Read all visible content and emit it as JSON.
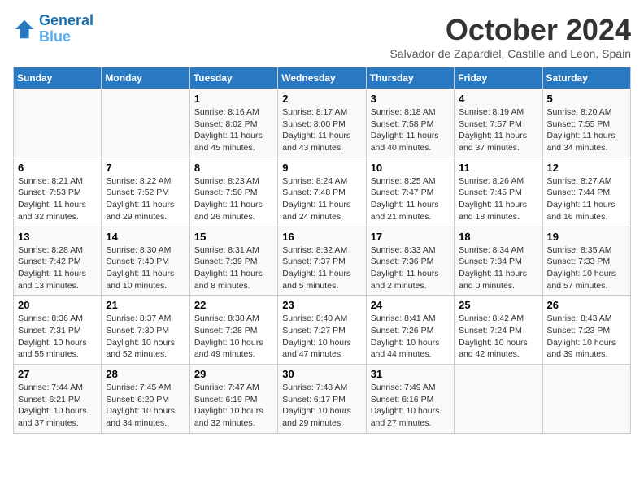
{
  "logo": {
    "line1": "General",
    "line2": "Blue"
  },
  "title": "October 2024",
  "subtitle": "Salvador de Zapardiel, Castille and Leon, Spain",
  "headers": [
    "Sunday",
    "Monday",
    "Tuesday",
    "Wednesday",
    "Thursday",
    "Friday",
    "Saturday"
  ],
  "weeks": [
    [
      {
        "day": "",
        "info": ""
      },
      {
        "day": "",
        "info": ""
      },
      {
        "day": "1",
        "sunrise": "8:16 AM",
        "sunset": "8:02 PM",
        "daylight": "11 hours and 45 minutes."
      },
      {
        "day": "2",
        "sunrise": "8:17 AM",
        "sunset": "8:00 PM",
        "daylight": "11 hours and 43 minutes."
      },
      {
        "day": "3",
        "sunrise": "8:18 AM",
        "sunset": "7:58 PM",
        "daylight": "11 hours and 40 minutes."
      },
      {
        "day": "4",
        "sunrise": "8:19 AM",
        "sunset": "7:57 PM",
        "daylight": "11 hours and 37 minutes."
      },
      {
        "day": "5",
        "sunrise": "8:20 AM",
        "sunset": "7:55 PM",
        "daylight": "11 hours and 34 minutes."
      }
    ],
    [
      {
        "day": "6",
        "sunrise": "8:21 AM",
        "sunset": "7:53 PM",
        "daylight": "11 hours and 32 minutes."
      },
      {
        "day": "7",
        "sunrise": "8:22 AM",
        "sunset": "7:52 PM",
        "daylight": "11 hours and 29 minutes."
      },
      {
        "day": "8",
        "sunrise": "8:23 AM",
        "sunset": "7:50 PM",
        "daylight": "11 hours and 26 minutes."
      },
      {
        "day": "9",
        "sunrise": "8:24 AM",
        "sunset": "7:48 PM",
        "daylight": "11 hours and 24 minutes."
      },
      {
        "day": "10",
        "sunrise": "8:25 AM",
        "sunset": "7:47 PM",
        "daylight": "11 hours and 21 minutes."
      },
      {
        "day": "11",
        "sunrise": "8:26 AM",
        "sunset": "7:45 PM",
        "daylight": "11 hours and 18 minutes."
      },
      {
        "day": "12",
        "sunrise": "8:27 AM",
        "sunset": "7:44 PM",
        "daylight": "11 hours and 16 minutes."
      }
    ],
    [
      {
        "day": "13",
        "sunrise": "8:28 AM",
        "sunset": "7:42 PM",
        "daylight": "11 hours and 13 minutes."
      },
      {
        "day": "14",
        "sunrise": "8:30 AM",
        "sunset": "7:40 PM",
        "daylight": "11 hours and 10 minutes."
      },
      {
        "day": "15",
        "sunrise": "8:31 AM",
        "sunset": "7:39 PM",
        "daylight": "11 hours and 8 minutes."
      },
      {
        "day": "16",
        "sunrise": "8:32 AM",
        "sunset": "7:37 PM",
        "daylight": "11 hours and 5 minutes."
      },
      {
        "day": "17",
        "sunrise": "8:33 AM",
        "sunset": "7:36 PM",
        "daylight": "11 hours and 2 minutes."
      },
      {
        "day": "18",
        "sunrise": "8:34 AM",
        "sunset": "7:34 PM",
        "daylight": "11 hours and 0 minutes."
      },
      {
        "day": "19",
        "sunrise": "8:35 AM",
        "sunset": "7:33 PM",
        "daylight": "10 hours and 57 minutes."
      }
    ],
    [
      {
        "day": "20",
        "sunrise": "8:36 AM",
        "sunset": "7:31 PM",
        "daylight": "10 hours and 55 minutes."
      },
      {
        "day": "21",
        "sunrise": "8:37 AM",
        "sunset": "7:30 PM",
        "daylight": "10 hours and 52 minutes."
      },
      {
        "day": "22",
        "sunrise": "8:38 AM",
        "sunset": "7:28 PM",
        "daylight": "10 hours and 49 minutes."
      },
      {
        "day": "23",
        "sunrise": "8:40 AM",
        "sunset": "7:27 PM",
        "daylight": "10 hours and 47 minutes."
      },
      {
        "day": "24",
        "sunrise": "8:41 AM",
        "sunset": "7:26 PM",
        "daylight": "10 hours and 44 minutes."
      },
      {
        "day": "25",
        "sunrise": "8:42 AM",
        "sunset": "7:24 PM",
        "daylight": "10 hours and 42 minutes."
      },
      {
        "day": "26",
        "sunrise": "8:43 AM",
        "sunset": "7:23 PM",
        "daylight": "10 hours and 39 minutes."
      }
    ],
    [
      {
        "day": "27",
        "sunrise": "7:44 AM",
        "sunset": "6:21 PM",
        "daylight": "10 hours and 37 minutes."
      },
      {
        "day": "28",
        "sunrise": "7:45 AM",
        "sunset": "6:20 PM",
        "daylight": "10 hours and 34 minutes."
      },
      {
        "day": "29",
        "sunrise": "7:47 AM",
        "sunset": "6:19 PM",
        "daylight": "10 hours and 32 minutes."
      },
      {
        "day": "30",
        "sunrise": "7:48 AM",
        "sunset": "6:17 PM",
        "daylight": "10 hours and 29 minutes."
      },
      {
        "day": "31",
        "sunrise": "7:49 AM",
        "sunset": "6:16 PM",
        "daylight": "10 hours and 27 minutes."
      },
      {
        "day": "",
        "info": ""
      },
      {
        "day": "",
        "info": ""
      }
    ]
  ]
}
